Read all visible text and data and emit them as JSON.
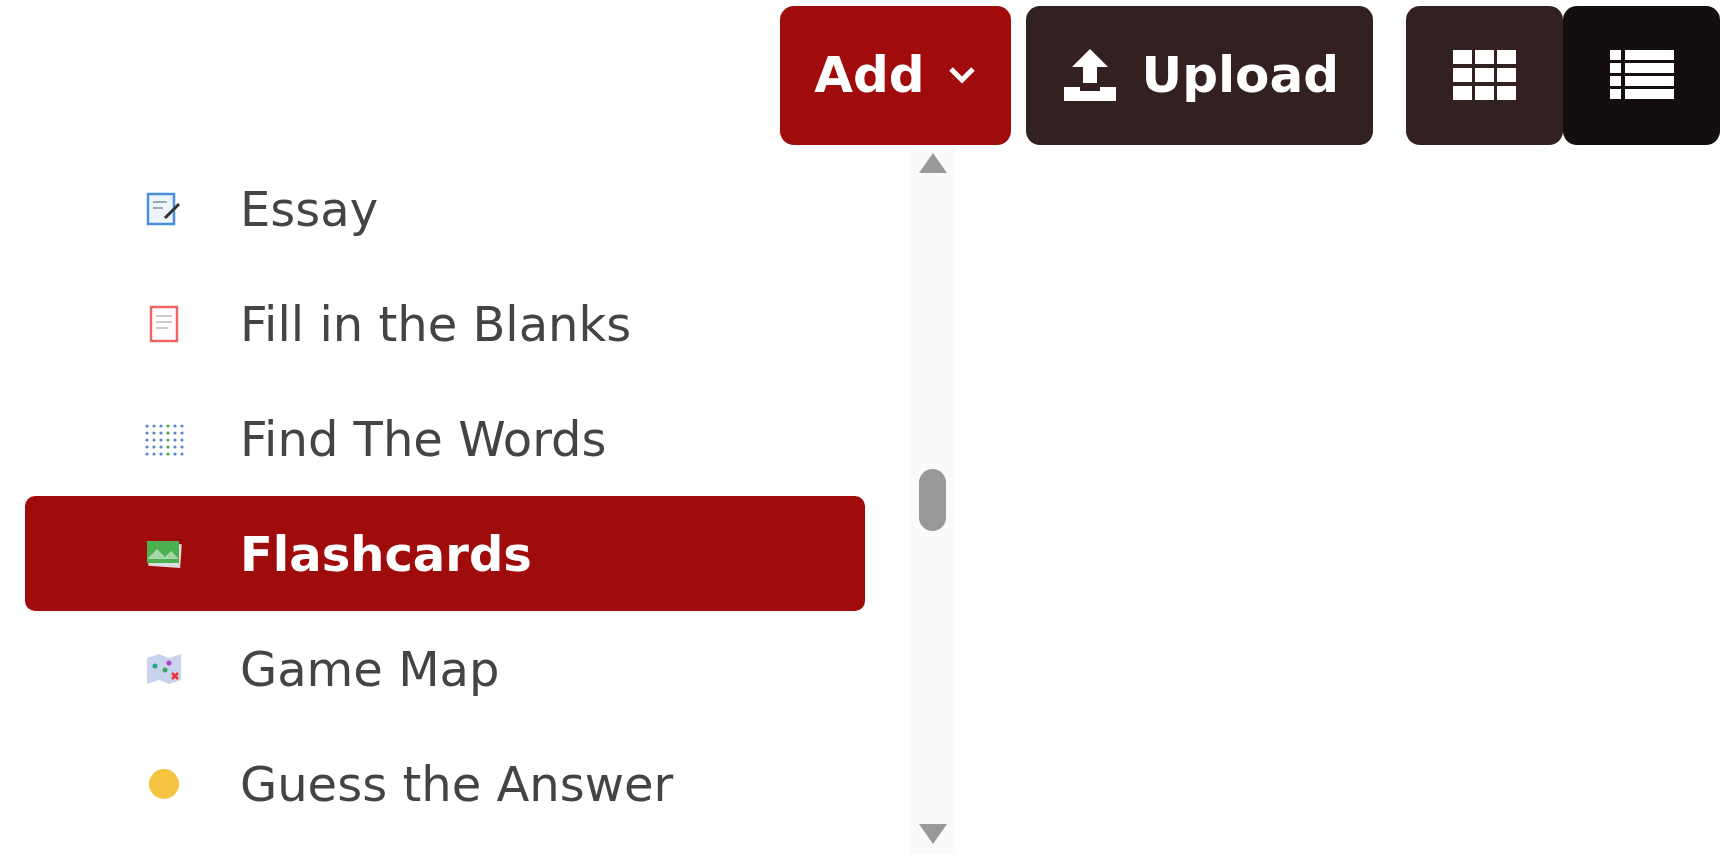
{
  "toolbar": {
    "add_button": {
      "label": "Add"
    },
    "upload_button": {
      "label": "Upload"
    },
    "view_buttons": [
      {
        "kind": "grid",
        "selected": false
      },
      {
        "kind": "list",
        "selected": true
      }
    ]
  },
  "menu": {
    "items": [
      {
        "label": "Essay",
        "kind": "essay",
        "selected": false
      },
      {
        "label": "Fill in the Blanks",
        "kind": "blanks",
        "selected": false
      },
      {
        "label": "Find The Words",
        "kind": "words",
        "selected": false
      },
      {
        "label": "Flashcards",
        "kind": "flashcards",
        "selected": true
      },
      {
        "label": "Game Map",
        "kind": "map",
        "selected": false
      },
      {
        "label": "Guess the Answer",
        "kind": "guess",
        "selected": false
      }
    ]
  }
}
